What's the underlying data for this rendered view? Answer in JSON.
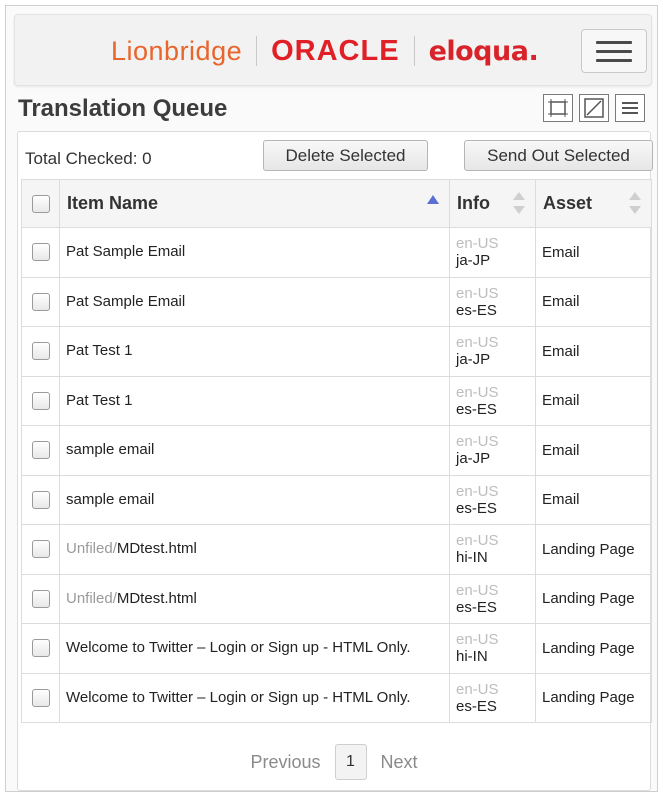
{
  "header": {
    "logo_lionbridge": "Lionbridge",
    "logo_oracle": "ORACLE",
    "logo_eloqua": "eloqua."
  },
  "page": {
    "title": "Translation Queue"
  },
  "toolbar": {
    "total_checked": "Total Checked: 0",
    "delete_label": "Delete Selected",
    "send_label": "Send Out Selected"
  },
  "table": {
    "columns": [
      "Item Name",
      "Info",
      "Asset"
    ],
    "sort": {
      "column": "Item Name",
      "direction": "ascending"
    },
    "rows": [
      {
        "folder": "",
        "name": "Pat Sample Email",
        "source": "en-US",
        "target": "ja-JP",
        "asset": "Email"
      },
      {
        "folder": "",
        "name": "Pat Sample Email",
        "source": "en-US",
        "target": "es-ES",
        "asset": "Email"
      },
      {
        "folder": "",
        "name": "Pat Test 1",
        "source": "en-US",
        "target": "ja-JP",
        "asset": "Email"
      },
      {
        "folder": "",
        "name": "Pat Test 1",
        "source": "en-US",
        "target": "es-ES",
        "asset": "Email"
      },
      {
        "folder": "",
        "name": "sample email",
        "source": "en-US",
        "target": "ja-JP",
        "asset": "Email"
      },
      {
        "folder": "",
        "name": "sample email",
        "source": "en-US",
        "target": "es-ES",
        "asset": "Email"
      },
      {
        "folder": "Unfiled/",
        "name": "MDtest.html",
        "source": "en-US",
        "target": "hi-IN",
        "asset": "Landing Page"
      },
      {
        "folder": "Unfiled/",
        "name": "MDtest.html",
        "source": "en-US",
        "target": "es-ES",
        "asset": "Landing Page"
      },
      {
        "folder": "",
        "name": "Welcome to Twitter – Login or Sign up - HTML Only.",
        "source": "en-US",
        "target": "hi-IN",
        "asset": "Landing Page"
      },
      {
        "folder": "",
        "name": "Welcome to Twitter – Login or Sign up - HTML Only.",
        "source": "en-US",
        "target": "es-ES",
        "asset": "Landing Page"
      }
    ]
  },
  "pager": {
    "previous": "Previous",
    "current": "1",
    "next": "Next"
  },
  "colors": {
    "lionbridge_orange": "#e8652c",
    "oracle_red": "#e01f26",
    "eloqua_red": "#d8232a",
    "sort_indicator": "#5a6fd6"
  },
  "icons": [
    "hamburger-menu-icon",
    "fit-view-icon",
    "expand-icon",
    "list-view-icon"
  ]
}
